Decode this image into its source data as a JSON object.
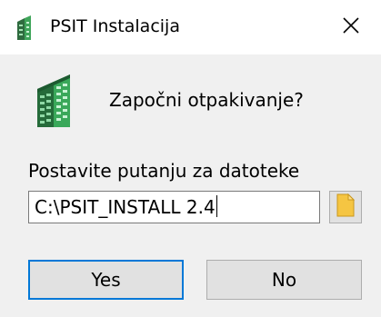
{
  "window": {
    "title": "PSIT Instalacija",
    "icon": "building-icon",
    "close_icon": "close-icon"
  },
  "dialog": {
    "prompt": "Započni otpakivanje?",
    "path_label": "Postavite putanju za datoteke",
    "path_value": "C:\\PSIT_INSTALL 2.4",
    "browse_icon": "folder-icon",
    "yes_label": "Yes",
    "no_label": "No"
  },
  "colors": {
    "window_background": "#f0f0f0",
    "titlebar_background": "#ffffff",
    "button_background": "#e1e1e1",
    "focus_border": "#0078d7",
    "building_green": "#2e8b57",
    "folder_yellow": "#f5c542"
  }
}
